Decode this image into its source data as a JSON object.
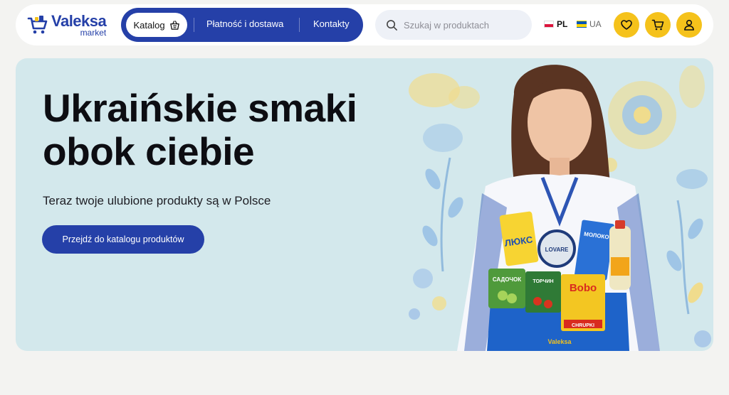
{
  "brand": {
    "name": "Valeksa",
    "sub": "market",
    "bag_text": "Valeksa"
  },
  "nav": {
    "catalog_label": "Katalog",
    "links": [
      "Płatność i dostawa",
      "Kontakty"
    ]
  },
  "search": {
    "placeholder": "Szukaj w produktach",
    "value": ""
  },
  "languages": [
    {
      "code": "PL",
      "active": true
    },
    {
      "code": "UA",
      "active": false
    }
  ],
  "header_icons": [
    "heart-icon",
    "cart-icon",
    "user-icon"
  ],
  "hero": {
    "title_line1": "Ukraińskie smaki",
    "title_line2": "obok ciebie",
    "subtitle": "Teraz twoje ulubione produkty są w Polsce",
    "cta_label": "Przejdź do katalogu produktów",
    "product_labels": [
      "ЛЮКС",
      "LOVARE",
      "МОЛОКО",
      "САДОЧОК",
      "ТОРЧИН",
      "Bobo",
      "CHRUPKI"
    ]
  },
  "colors": {
    "brand_blue": "#2540a8",
    "accent_yellow": "#f5c21b",
    "hero_bg": "#d3e8ec",
    "page_bg": "#f3f3f1"
  }
}
